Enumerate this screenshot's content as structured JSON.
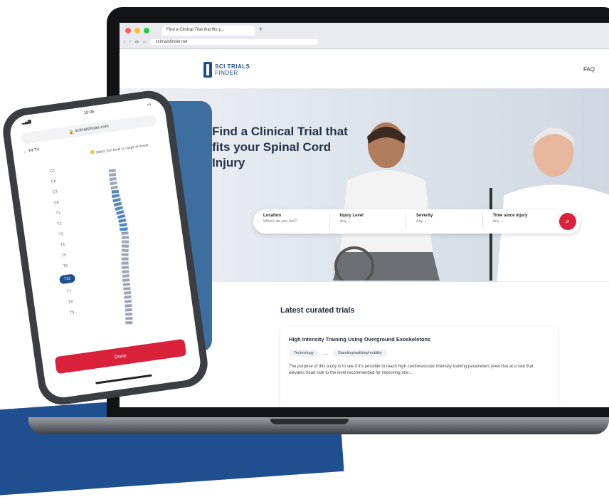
{
  "browser": {
    "tab_title": "Find a Clinical Trial that fits y...",
    "url": "scitrialsfinder.net"
  },
  "site": {
    "logo_line1": "SCI TRIALS",
    "logo_line2": "FINDER",
    "nav_faq": "FAQ"
  },
  "hero": {
    "title": "Find a Clinical Trial that fits your Spinal Cord Injury"
  },
  "search": {
    "fields": [
      {
        "label": "Location",
        "value": "Where do you live?"
      },
      {
        "label": "Injury Level",
        "value": "Any"
      },
      {
        "label": "Severity",
        "value": "Any"
      },
      {
        "label": "Time since injury",
        "value": "Any"
      }
    ]
  },
  "latest": {
    "heading": "Latest curated trials",
    "card": {
      "title": "High Intensity Training Using Overground Exoskeletons",
      "chip1": "Technology",
      "chip2": "Standing/walking/mobility",
      "description": "The purpose of this study is to see if it's possible to reach high cardiovascular intensity training parameters (exercise at a rate that elevates heart rate to the level recommended for improving stre..."
    }
  },
  "phone": {
    "time": "10:06",
    "url": "scitrialsfinder.com",
    "back_label": "T4 T4",
    "note": "Select SCI level or range of levels",
    "levels": [
      "C5",
      "C6",
      "C7",
      "C8",
      "T1",
      "T2",
      "T3",
      "T4",
      "T5",
      "T6",
      "T7",
      "T8",
      "T9",
      "T10",
      "T11",
      "T12"
    ],
    "selected_level": "T12",
    "done_label": "Done"
  },
  "colors": {
    "brand_blue": "#1f4f8f",
    "accent_red": "#d9213b"
  }
}
